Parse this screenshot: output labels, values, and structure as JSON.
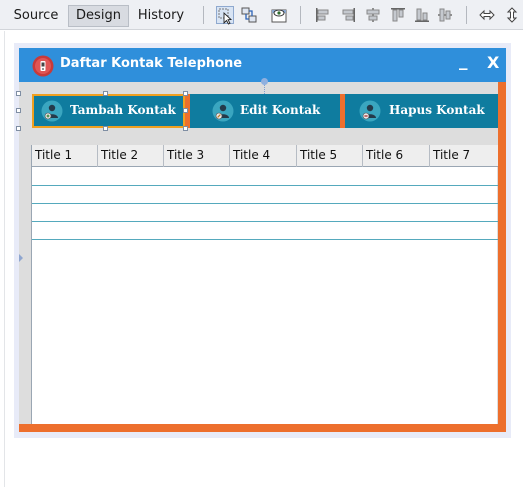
{
  "ide": {
    "tabs": [
      {
        "label": "Source",
        "active": false
      },
      {
        "label": "Design",
        "active": true
      },
      {
        "label": "History",
        "active": false
      }
    ],
    "tool_icons": [
      "selection-mode-icon",
      "connection-mode-icon",
      "preview-design-icon",
      "align-left-icon",
      "align-right-icon",
      "center-horizontally-icon",
      "align-top-icon",
      "align-bottom-icon",
      "center-vertically-icon",
      "change-horizontal-resizability-icon",
      "change-vertical-resizability-icon"
    ]
  },
  "window": {
    "title": "Daftar Kontak Telephone",
    "minimize_label": "_",
    "close_label": "X",
    "colors": {
      "titlebar": "#2f8fdb",
      "frame": "#ed6f2d"
    }
  },
  "buttons": [
    {
      "label": "Tambah Kontak",
      "icon": "user-add-icon"
    },
    {
      "label": "Edit Kontak",
      "icon": "user-edit-icon"
    },
    {
      "label": "Hapus Kontak",
      "icon": "user-delete-icon"
    }
  ],
  "button_color": "#0f7c9f",
  "table": {
    "columns": [
      "Title 1",
      "Title 2",
      "Title 3",
      "Title 4",
      "Title 5",
      "Title 6",
      "Title 7"
    ],
    "rows": [
      [
        "",
        "",
        "",
        "",
        "",
        "",
        ""
      ],
      [
        "",
        "",
        "",
        "",
        "",
        "",
        ""
      ],
      [
        "",
        "",
        "",
        "",
        "",
        "",
        ""
      ],
      [
        "",
        "",
        "",
        "",
        "",
        "",
        ""
      ]
    ]
  }
}
